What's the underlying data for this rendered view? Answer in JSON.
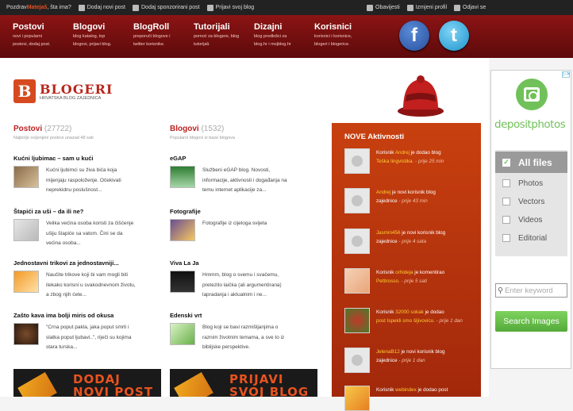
{
  "topbar": {
    "greeting_prefix": "Pozdrav ",
    "username": "Matejaš",
    "greeting_suffix": ", šta ima?",
    "links": [
      "Dodaj novi post",
      "Dodaj sponzorirani post",
      "Prijavi svoj blog"
    ],
    "right_links": [
      "Obavijesti",
      "Izmjeni profil",
      "Odjavi se"
    ]
  },
  "nav": [
    {
      "title": "Postovi",
      "desc1": "novi i popularni",
      "desc2": "postovi, dodaj post."
    },
    {
      "title": "Blogovi",
      "desc1": "blog katalog, top",
      "desc2": "blogovi, prijavi blog."
    },
    {
      "title": "BlogRoll",
      "desc1": "preporuči blogove i",
      "desc2": "twitter korisnike."
    },
    {
      "title": "Tutorijali",
      "desc1": "pomoć za blogere, blog",
      "desc2": "tutorijali."
    },
    {
      "title": "Dizajni",
      "desc1": "blog predlošci za",
      "desc2": "blog.hr i mojblog.hr"
    },
    {
      "title": "Korisnici",
      "desc1": "korisnici i korisnice,",
      "desc2": "blogeri i blogerice."
    }
  ],
  "social": {
    "facebook": "f",
    "twitter": "t"
  },
  "logo": {
    "letter": "B",
    "name": "BLOGERI",
    "tagline": "HRVATSKA BLOG ZAJEDNICA"
  },
  "postovi": {
    "title": "Postovi",
    "count": "(27722)",
    "sub": "Najbolje ocijenjeni postovi unazad 48 sati",
    "items": [
      {
        "title": "Kućni ljubimac – sam u kući",
        "lines": [
          "Kućni ljubimci su živa bića koja",
          "mijenjaju raspoloženje. Očekivati",
          "neprekidnu poslušnost..."
        ]
      },
      {
        "title": "Štapići za uši – da ili ne?",
        "lines": [
          "Velika većina osoba koristi za čišćenje",
          "ušiju štapiće sa vatom. Čini se da",
          "većina osoba..."
        ]
      },
      {
        "title": "Jednostavni trikovi za jednostavniji...",
        "lines": [
          "Naučite trikove koji bi vam mogli biti",
          "itekako korisni u svakodnevnom životu,",
          "a zbog njih ćete..."
        ]
      },
      {
        "title": "Zašto kava ima bolji miris od okusa",
        "lines": [
          "\"Crna poput pakla, jaka poput smrti i",
          "slatka poput ljubavi..\", riječi su kojima",
          "stara turska..."
        ]
      }
    ]
  },
  "blogovi": {
    "title": "Blogovi",
    "count": "(1532)",
    "sub": "Popularni blogovi iz baze blogova",
    "items": [
      {
        "title": "eGAP",
        "lines": [
          "Službeni eGAP blog. Novosti,",
          "informacije, aktivnosti i događanja na",
          "temu internet aplikacije za..."
        ]
      },
      {
        "title": "Fotografije",
        "lines": [
          "Fotografije iz cijeloga svijeta",
          "",
          ""
        ]
      },
      {
        "title": "Viva La Ja",
        "lines": [
          "Hmmm, blog o svemu i svačemu,",
          "pretezito laička (ali argumentirana)",
          "lapradanja i aktualnim i ne..."
        ]
      },
      {
        "title": "Edenski vrt",
        "lines": [
          "Blog koji se bavi razmišljanjima o",
          "raznim životnim temama, a sve to iz",
          "biblijske perspektive."
        ]
      }
    ]
  },
  "banners": [
    {
      "line1": "DODAJ",
      "line2": "NOVI POST"
    },
    {
      "line1": "PRIJAVI",
      "line2": "SVOJ BLOG"
    }
  ],
  "activity": {
    "title": "NOVE Aktivnosti",
    "entries": [
      {
        "pre": "Korisnik ",
        "user": "Andrej",
        "mid": " je dodao blog",
        "obj": "Teška lingvistika.",
        "time": " - prije 25 min",
        "avatar": "placeholder"
      },
      {
        "pre": "",
        "user": "Andrej",
        "mid": " je novi korisnik blog",
        "obj": "zajednice",
        "time": " - prije 43 min",
        "avatar": "placeholder"
      },
      {
        "pre": "",
        "user": "Jasmin456",
        "mid": " je novi korisnik blog",
        "obj": "zajednice",
        "time": " - prije 4 sata",
        "avatar": "placeholder"
      },
      {
        "pre": "Korisnik ",
        "user": "orhideja",
        "mid": " je komentirao",
        "obj": "Pettirosso.",
        "time": " - prije 5 sati",
        "avatar": "photo"
      },
      {
        "pre": "Korisnik ",
        "user": "32000 sokak",
        "mid": " je dodao",
        "obj": "post Ispekli smo šljivovicu.",
        "time": " - prije 1 dan",
        "avatar": "photo"
      },
      {
        "pre": "",
        "user": "JelenaB12",
        "mid": " je novi korisnik blog",
        "obj": "zajednice",
        "time": " - prije 1 dan",
        "avatar": "placeholder"
      },
      {
        "pre": "Korisnik ",
        "user": "webindex",
        "mid": " je dodao post",
        "obj": "",
        "time": "",
        "avatar": "photo"
      }
    ]
  },
  "ad": {
    "brand": "depositphotos",
    "options": [
      "All files",
      "Photos",
      "Vectors",
      "Videos",
      "Editorial"
    ],
    "search_placeholder": "Enter keyword",
    "button": "Search Images",
    "close": "▷✕"
  },
  "colors": {
    "accent": "#b22222",
    "nav": "#7a0e0f",
    "activity": "#b8320f",
    "ad_green": "#71c15a"
  }
}
